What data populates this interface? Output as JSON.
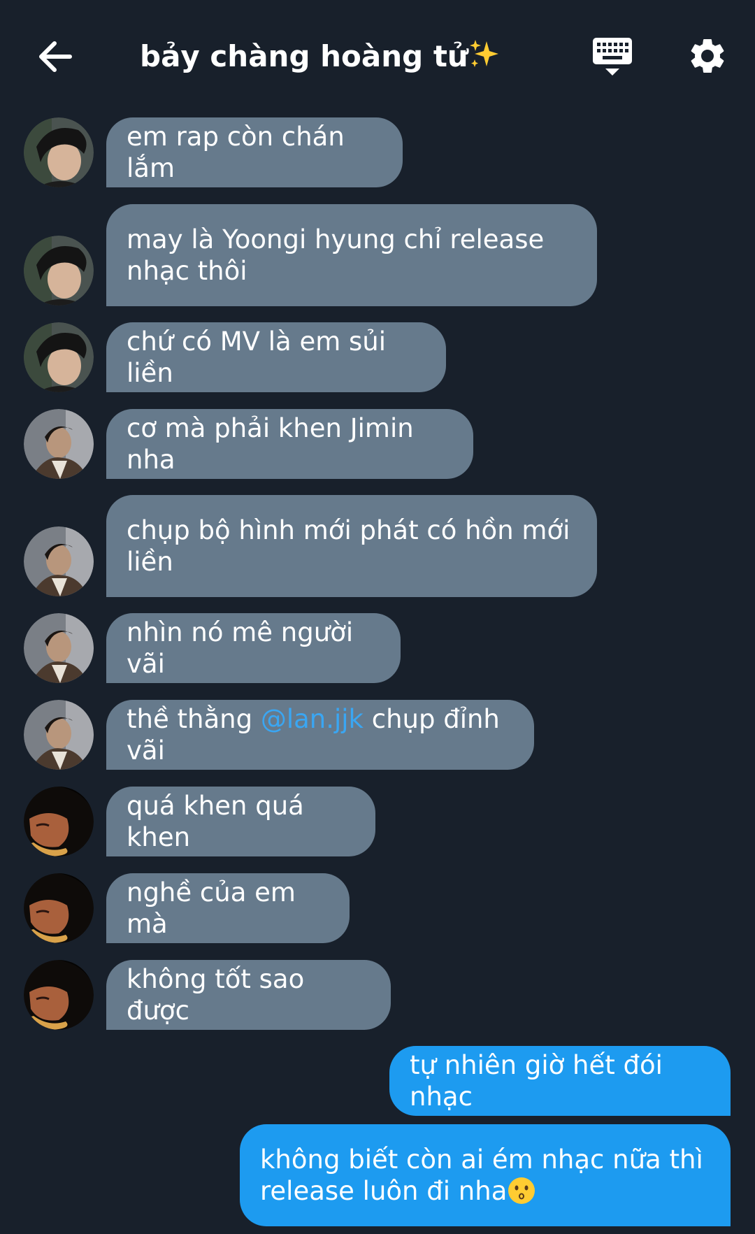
{
  "header": {
    "title": "bảy chàng hoàng tử"
  },
  "messages": [
    {
      "text": "em rap còn chán lắm"
    },
    {
      "text": "may là Yoongi hyung chỉ release\nnhạc thôi"
    },
    {
      "text": "chứ có MV là em sủi liền"
    },
    {
      "text": "cơ mà phải khen Jimin nha"
    },
    {
      "text": "chụp bộ hình mới phát có hồn mới\nliền"
    },
    {
      "text": "nhìn nó mê người vãi"
    },
    {
      "pre": "thề thằng ",
      "mention": "@lan.jjk",
      "post": " chụp đỉnh vãi"
    },
    {
      "text": "quá khen quá khen"
    },
    {
      "text": "nghề của em mà"
    },
    {
      "text": "không tốt sao được"
    },
    {
      "text": "tự nhiên giờ hết đói nhạc"
    },
    {
      "line1": "không biết còn ai ém nhạc nữa thì",
      "line2": "release luôn đi nha"
    }
  ],
  "colors": {
    "background": "#18202b",
    "incoming_bubble": "#667a8c",
    "outgoing_bubble": "#1d9bf0",
    "mention": "#3aa6f2"
  },
  "icons": [
    "back-arrow-icon",
    "sparkles-icon",
    "keyboard-icon",
    "gear-icon",
    "kissing-face-emoji"
  ]
}
